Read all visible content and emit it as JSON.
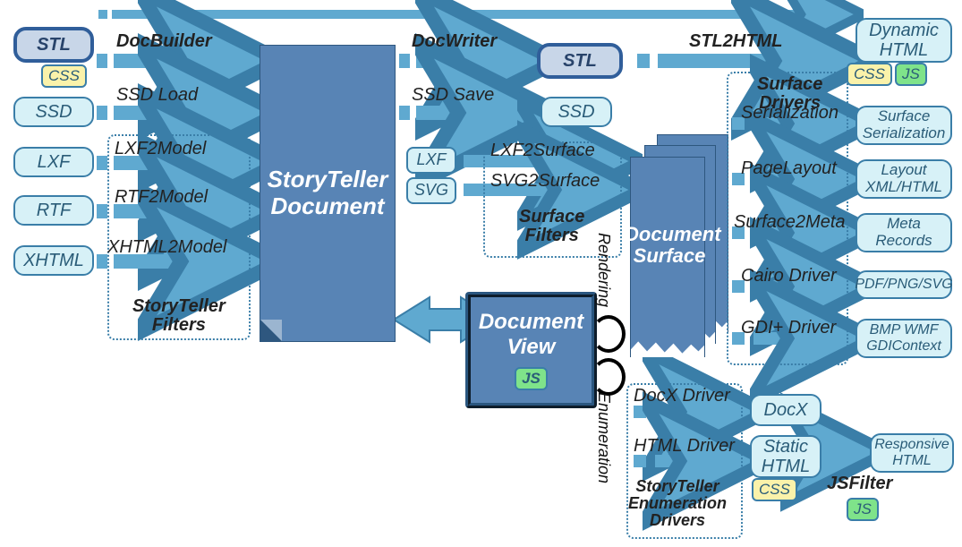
{
  "nodes": {
    "stl1": "STL",
    "ssd_in": "SSD",
    "lxf_in": "LXF",
    "rtf_in": "RTF",
    "xhtml_in": "XHTML",
    "storyteller_doc": "StoryTeller\nDocument",
    "stl2": "STL",
    "ssd_mid": "SSD",
    "lxf_mid": "LXF",
    "svg_mid": "SVG",
    "docview": "Document\nView",
    "docsurface": "Document\nSurface",
    "dyn_html": "Dynamic\nHTML",
    "surf_serial": "Surface\nSerialization",
    "layout_xml": "Layout\nXML/HTML",
    "meta_rec": "Meta\nRecords",
    "pdf": "PDF/PNG/SVG",
    "bmp": "BMP WMF\nGDIContext",
    "docx": "DocX",
    "static_html": "Static\nHTML",
    "resp_html": "Responsive\nHTML"
  },
  "badges": {
    "css": "CSS",
    "js": "JS"
  },
  "labels": {
    "docbuilder": "DocBuilder",
    "docwriter": "DocWriter",
    "stl2html": "STL2HTML",
    "ssdload": "SSD Load",
    "ssdsave": "SSD Save",
    "lxf2model": "LXF2Model",
    "rtf2model": "RTF2Model",
    "xhtml2model": "XHTML2Model",
    "st_filters": "StoryTeller\nFilters",
    "lxf2surf": "LXF2Surface",
    "svg2surf": "SVG2Surface",
    "surf_filters": "Surface\nFilters",
    "surf_drivers": "Surface\nDrivers",
    "serialization": "Serialization",
    "pagelayout": "PageLayout",
    "surf2meta": "Surface2Meta",
    "cairo": "Cairo Driver",
    "gdi": "GDI+ Driver",
    "docx_drv": "DocX Driver",
    "html_drv": "HTML Driver",
    "enum_drivers": "StoryTeller\nEnumeration\nDrivers",
    "jsfilter": "JSFilter",
    "rendering": "Rendering",
    "enumeration": "Enumeration"
  },
  "colors": {
    "arrow": "#5fa9d0",
    "arrow_stroke": "#3a7ea8"
  }
}
